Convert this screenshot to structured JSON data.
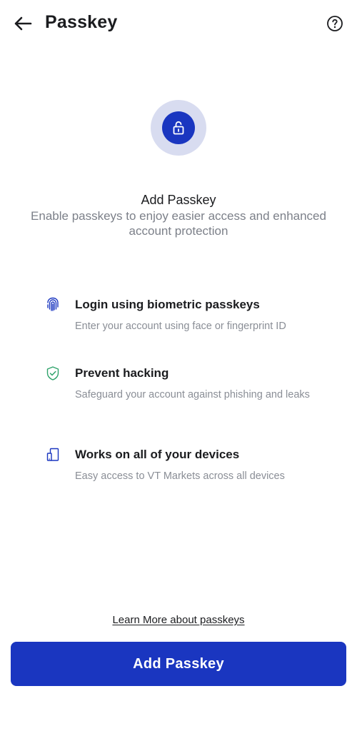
{
  "header": {
    "title": "Passkey",
    "back_icon": "arrow-left-icon",
    "help_icon": "question-circle-icon"
  },
  "hero": {
    "icon": "unlock-icon"
  },
  "intro": {
    "title": "Add Passkey",
    "description": "Enable passkeys to enjoy easier access and enhanced account protection"
  },
  "features": [
    {
      "icon": "fingerprint-icon",
      "title": "Login using biometric passkeys",
      "description": "Enter your account using face or fingerprint ID"
    },
    {
      "icon": "shield-check-icon",
      "title": "Prevent hacking",
      "description": "Safeguard your account against phishing and leaks"
    },
    {
      "icon": "devices-icon",
      "title": "Works on all of your devices",
      "description": "Easy access to VT Markets across all devices"
    }
  ],
  "footer": {
    "learn_more": "Learn More about passkeys",
    "primary_button": "Add Passkey"
  },
  "colors": {
    "primary": "#1a36c0",
    "hero_ring": "#d8dcf0",
    "shield_green": "#2fa36b",
    "muted_text": "#7c8089"
  }
}
